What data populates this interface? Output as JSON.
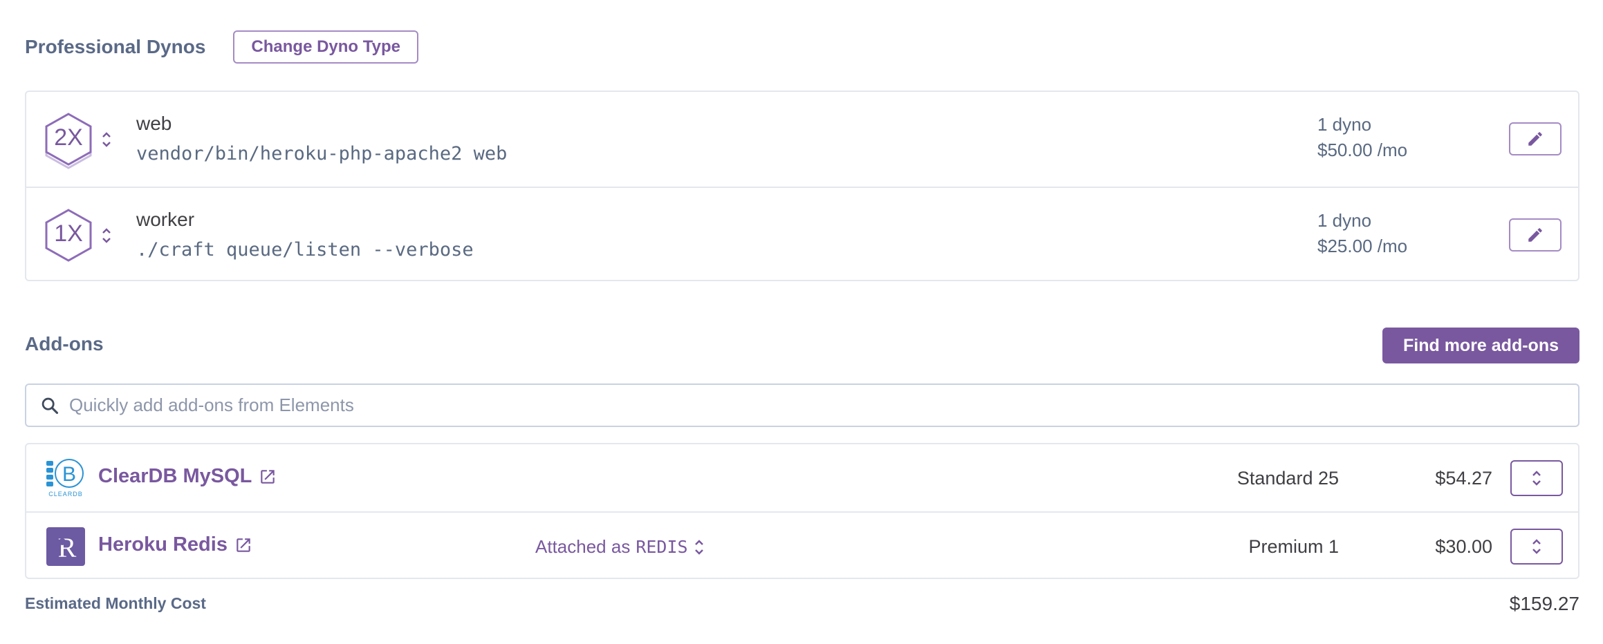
{
  "dynos": {
    "title": "Professional Dynos",
    "change_type_label": "Change Dyno Type",
    "rows": [
      {
        "size": "2X",
        "name": "web",
        "command": "vendor/bin/heroku-php-apache2 web",
        "count": "1 dyno",
        "price": "$50.00 /mo"
      },
      {
        "size": "1X",
        "name": "worker",
        "command": "./craft queue/listen --verbose",
        "count": "1 dyno",
        "price": "$25.00 /mo"
      }
    ]
  },
  "addons": {
    "title": "Add-ons",
    "find_more_label": "Find more add-ons",
    "search_placeholder": "Quickly add add-ons from Elements",
    "rows": [
      {
        "name": "ClearDB MySQL",
        "logo_text": "CLEARDB",
        "attached_prefix": "",
        "attached_name": "",
        "plan": "Standard 25",
        "price": "$54.27"
      },
      {
        "name": "Heroku Redis",
        "logo_text": "",
        "attached_prefix": "Attached as",
        "attached_name": "REDIS",
        "plan": "Premium 1",
        "price": "$30.00"
      }
    ]
  },
  "cost": {
    "label": "Estimated Monthly Cost",
    "value": "$159.27"
  },
  "colors": {
    "accent": "#79589f",
    "heading": "#5a6987",
    "border": "#e3e7ee",
    "cleardb_blue": "#2a93d5"
  }
}
